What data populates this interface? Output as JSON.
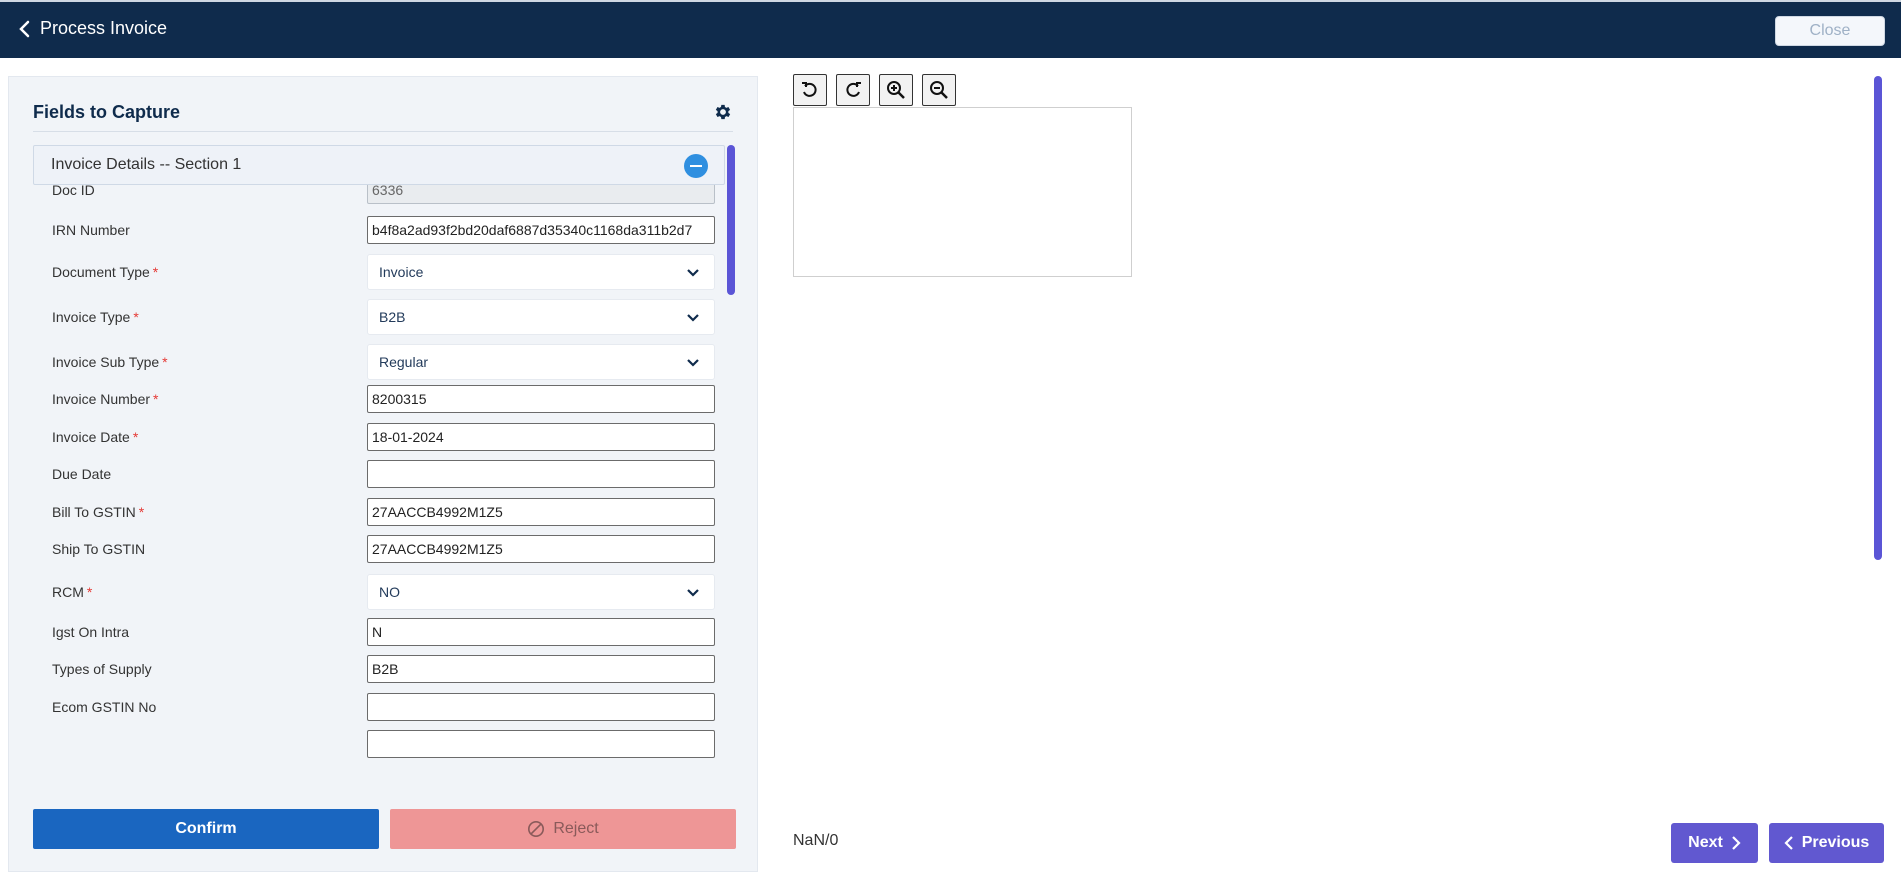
{
  "header": {
    "back_label": "Process Invoice",
    "close_label": "Close"
  },
  "panel": {
    "title": "Fields to Capture",
    "section_label": "Invoice Details -- Section 1"
  },
  "fields": [
    {
      "label": "Doc ID",
      "type": "input",
      "value": "6336",
      "required": false,
      "disabled": true
    },
    {
      "label": "IRN Number",
      "type": "input",
      "value": "b4f8a2ad93f2bd20daf6887d35340c1168da311b2d7",
      "required": false
    },
    {
      "label": "Document Type",
      "type": "select",
      "value": "Invoice",
      "required": true
    },
    {
      "label": "Invoice Type",
      "type": "select",
      "value": "B2B",
      "required": true
    },
    {
      "label": "Invoice Sub Type",
      "type": "select",
      "value": "Regular",
      "required": true
    },
    {
      "label": "Invoice Number",
      "type": "input",
      "value": "8200315",
      "required": true
    },
    {
      "label": "Invoice Date",
      "type": "input",
      "value": "18-01-2024",
      "required": true
    },
    {
      "label": "Due Date",
      "type": "input",
      "value": "",
      "required": false
    },
    {
      "label": "Bill To GSTIN",
      "type": "input",
      "value": "27AACCB4992M1Z5",
      "required": true
    },
    {
      "label": "Ship To GSTIN",
      "type": "input",
      "value": "27AACCB4992M1Z5",
      "required": false
    },
    {
      "label": "RCM",
      "type": "select",
      "value": "NO",
      "required": true
    },
    {
      "label": "Igst On Intra",
      "type": "input",
      "value": "N",
      "required": false
    },
    {
      "label": "Types of Supply",
      "type": "input",
      "value": "B2B",
      "required": false
    },
    {
      "label": "Ecom GSTIN No",
      "type": "input",
      "value": "",
      "required": false
    }
  ],
  "actions": {
    "confirm_label": "Confirm",
    "reject_label": "Reject"
  },
  "viewer": {
    "page_counter": "NaN/0",
    "next_label": "Next",
    "previous_label": "Previous",
    "tools": [
      "rotate-left-icon",
      "rotate-right-icon",
      "zoom-in-icon",
      "zoom-out-icon"
    ]
  },
  "colors": {
    "header_bg": "#0f2b4c",
    "confirm_bg": "#1a66c0",
    "reject_bg": "#ee9696",
    "nav_bg": "#6158d0",
    "required": "#e53935"
  }
}
